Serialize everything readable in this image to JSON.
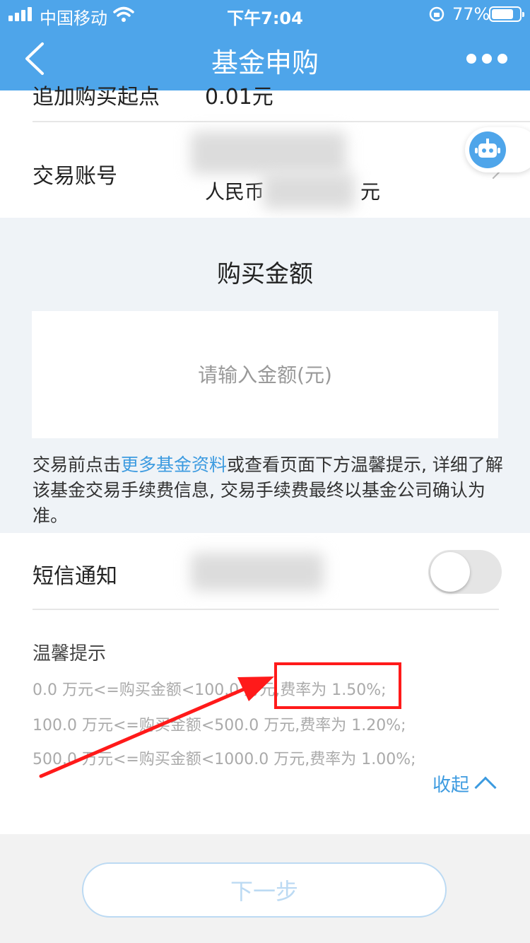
{
  "status_bar": {
    "carrier": "中国移动",
    "time": "下午7:04",
    "battery": "77%"
  },
  "nav": {
    "title": "基金申购"
  },
  "rows": {
    "add_purchase_label": "追加购买起点",
    "add_purchase_value": "0.01元",
    "account_label": "交易账号",
    "account_value_prefix": "人民币",
    "account_value_suffix": "元"
  },
  "amount": {
    "title": "购买金额",
    "placeholder": "请输入金额(元)"
  },
  "note": {
    "before": "交易前点击",
    "link": "更多基金资料",
    "after": "或查看页面下方温馨提示, 详细了解该基金交易手续费信息, 交易手续费最终以基金公司确认为准。"
  },
  "sms": {
    "label": "短信通知"
  },
  "tips": {
    "title": "温馨提示",
    "lines": [
      "0.0 万元<=购买金额<100.0 万元,费率为 1.50%;",
      "100.0 万元<=购买金额<500.0 万元,费率为 1.20%;",
      "500.0 万元<=购买金额<1000.0 万元,费率为 1.00%;"
    ],
    "collapse_label": "收起"
  },
  "footer": {
    "next_label": "下一步"
  },
  "colors": {
    "nav_bg": "#4ea5ea",
    "link": "#3d9be0",
    "highlight_box": "#ff1a1a",
    "arrow": "#ff1a1a"
  }
}
